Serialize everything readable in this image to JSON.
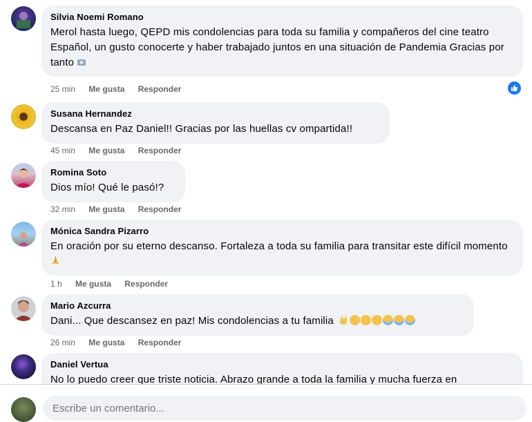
{
  "comments": [
    {
      "author": "Silvia Noemi Romano",
      "text": "Merol hasta luego, QEPD mis condolencias para toda su familia y compañeros del cine teatro Español, un gusto conocerte y haber trabajado juntos en una situación de Pandemia Gracias por tanto",
      "time": "25 min",
      "like": "Me gusta",
      "reply": "Responder",
      "avatar_icon": "avatar-photo-dark-blue",
      "reaction_icon": "like-reaction-icon"
    },
    {
      "author": "Susana Hernandez",
      "text": "Descansa en Paz Daniel!! Gracias por las huellas cv ompartida!!",
      "time": "45 min",
      "like": "Me gusta",
      "reply": "Responder",
      "avatar_icon": "avatar-photo-sunflower"
    },
    {
      "author": "Romina Soto",
      "text": "Dios mío! Qué le pasó!?",
      "time": "32 min",
      "like": "Me gusta",
      "reply": "Responder",
      "avatar_icon": "avatar-photo-woman"
    },
    {
      "author": "Mónica Sandra Pizarro",
      "text": "En oración por su eterno descanso. Fortaleza a toda su familia para transitar este difícil momento",
      "time": "1 h",
      "like": "Me gusta",
      "reply": "Responder",
      "avatar_icon": "avatar-photo-beach",
      "emoji": "praying-hands-emoji"
    },
    {
      "author": "Mario Azcurra",
      "text": "Dani... Que descansez en paz! Mis condolencias a tu familia",
      "time": "26 min",
      "like": "Me gusta",
      "reply": "Responder",
      "avatar_icon": "avatar-photo-man",
      "emojis": [
        "rock-hand-emoji",
        "sad-face-emoji",
        "sad-face-emoji",
        "sad-face-emoji",
        "crying-face-emoji",
        "crying-face-emoji",
        "crying-face-emoji"
      ]
    },
    {
      "author": "Daniel Vertua",
      "text": "No lo puedo creer que triste noticia. Abrazo grande a toda la familia y mucha fuerza en",
      "avatar_icon": "avatar-photo-night"
    }
  ],
  "composer": {
    "placeholder": "Escribe un comentario..."
  },
  "colors": {
    "bubble": "#f0f2f5",
    "meta_text": "#65676b",
    "like_blue": "#1877f2"
  }
}
